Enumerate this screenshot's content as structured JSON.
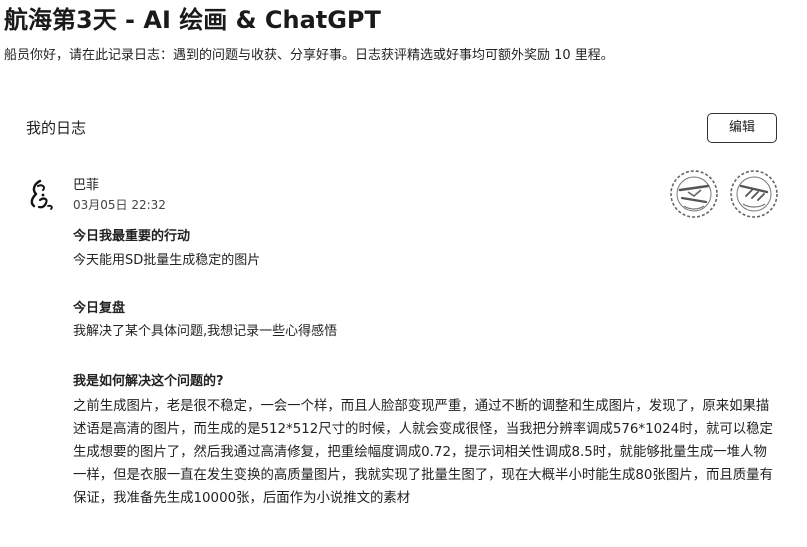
{
  "header": {
    "title": "航海第3天 - AI 绘画 & ChatGPT",
    "subtitle": "船员你好，请在此记录日志：遇到的问题与收获、分享好事。日志获评精选或好事均可额外奖励 10 里程。"
  },
  "journal": {
    "section_title": "我的日志",
    "edit_label": "编辑"
  },
  "post": {
    "author": "巴菲",
    "time": "03月05日 22:32",
    "sections": [
      {
        "heading": "今日我最重要的行动",
        "text": "今天能用SD批量生成稳定的图片"
      },
      {
        "heading": "今日复盘",
        "text": "我解决了某个具体问题,我想记录一些心得感悟"
      },
      {
        "heading": "我是如何解决这个问题的?",
        "text": "之前生成图片，老是很不稳定，一会一个样，而且人脸部变现严重，通过不断的调整和生成图片，发现了，原来如果描述语是高清的图片，而生成的是512*512尺寸的时候，人就会变成很怪，当我把分辨率调成576*1024时，就可以稳定生成想要的图片了，然后我通过高清修复，把重绘幅度调成0.72，提示词相关性调成8.5时，就能够批量生成一堆人物一样，但是衣服一直在发生变换的高质量图片，我就实现了批量生图了，现在大概半小时能生成80张图片，而且质量有保证，我准备先生成10000张，后面作为小说推文的素材"
      }
    ]
  },
  "icons": {
    "avatar": "avatar-sketch-icon",
    "stamp_1": "seal-stamp-icon",
    "stamp_2": "seal-stamp-icon"
  }
}
